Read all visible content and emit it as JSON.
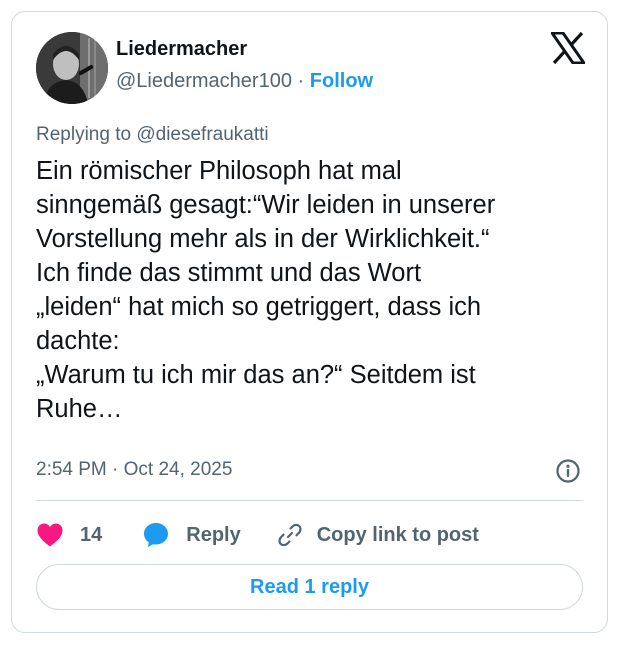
{
  "author": {
    "display_name": "Liedermacher",
    "handle": "@Liedermacher100",
    "separator": "·",
    "follow_label": "Follow"
  },
  "reply_context": {
    "prefix": "Replying to",
    "handle": "@diesefraukatti"
  },
  "tweet": {
    "text": "Ein römischer Philosoph hat mal\nsinngemäß gesagt:“Wir leiden in unserer\nVorstellung mehr als in der Wirklichkeit.“\nIch finde das stimmt und das Wort\n„leiden“ hat mich so getriggert, dass ich\ndachte:\n„Warum tu ich mir das an?“ Seitdem ist\nRuhe…",
    "timestamp": "2:54 PM · Oct 24, 2025"
  },
  "actions": {
    "like_count": "14",
    "reply_label": "Reply",
    "copy_link_label": "Copy link to post"
  },
  "read_replies_label": "Read 1 reply",
  "icons": {
    "brand": "x-logo-icon",
    "info": "info-icon",
    "like": "heart-icon",
    "reply": "speech-bubble-icon",
    "copy": "link-icon"
  },
  "colors": {
    "accent": "#1d9bf0",
    "like": "#f91880",
    "secondary_text": "#536471",
    "border": "#cfd9de",
    "text": "#0f1419"
  }
}
